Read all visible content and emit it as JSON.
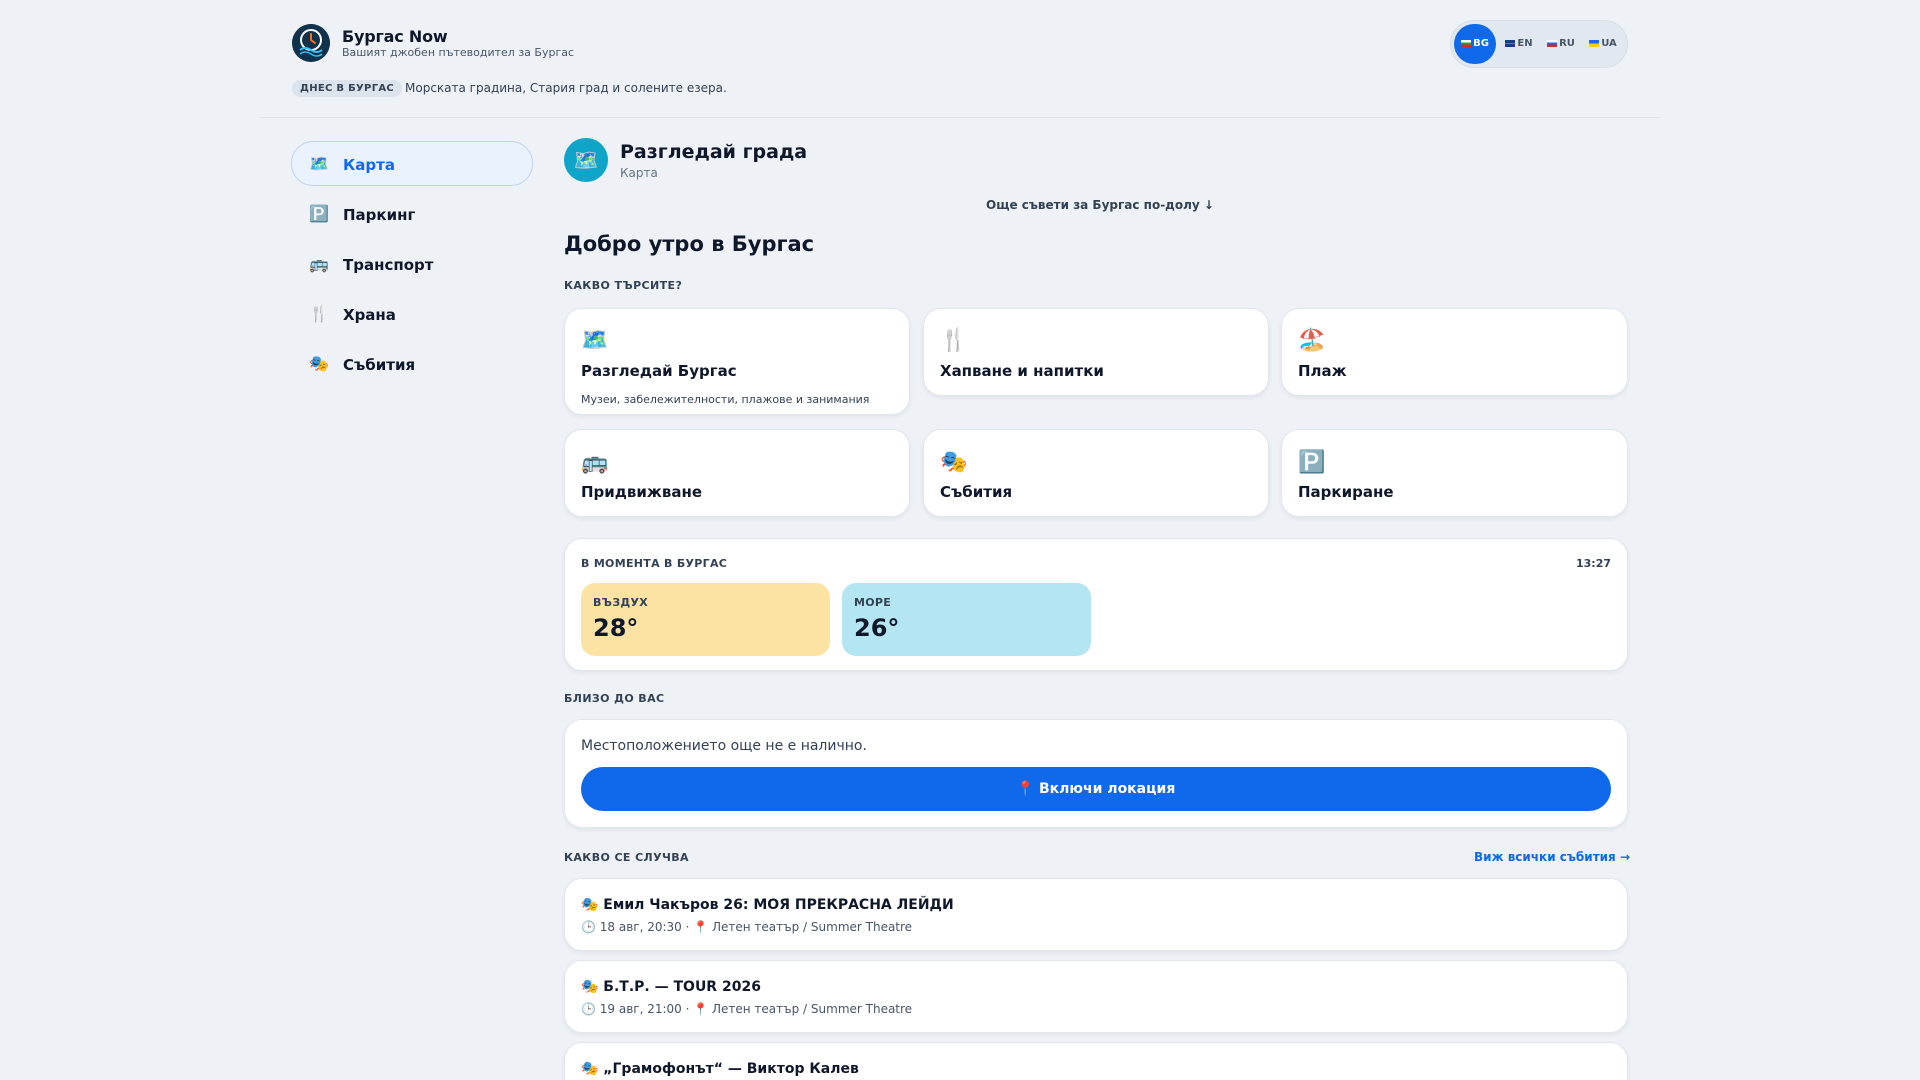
{
  "brand": {
    "title": "Бургас Now",
    "subtitle": "Вашият джобен пътеводител за Бургас",
    "logo_icon": "compass-clock-wave-logo"
  },
  "today": {
    "badge": "ДНЕС В БУРГАС",
    "text": "Морската градина, Стария град и солените езера."
  },
  "languages": [
    {
      "code": "BG",
      "flag": "bg-flag-icon",
      "active": true
    },
    {
      "code": "EN",
      "flag": "gb-flag-icon",
      "active": false
    },
    {
      "code": "RU",
      "flag": "ru-flag-icon",
      "active": false
    },
    {
      "code": "UA",
      "flag": "ua-flag-icon",
      "active": false
    }
  ],
  "sidebar": {
    "items": [
      {
        "label": "Карта",
        "icon": "🗺️",
        "icon_name": "map-icon",
        "active": true
      },
      {
        "label": "Паркинг",
        "icon": "🅿️",
        "icon_name": "parking-icon",
        "active": false
      },
      {
        "label": "Транспорт",
        "icon": "🚌",
        "icon_name": "bus-icon",
        "active": false
      },
      {
        "label": "Храна",
        "icon": "🍴",
        "icon_name": "fork-knife-icon",
        "active": false
      },
      {
        "label": "Събития",
        "icon": "🎭",
        "icon_name": "theater-masks-icon",
        "active": false
      }
    ]
  },
  "page": {
    "icon": "🗺️",
    "title": "Разгледай града",
    "subtitle": "Карта",
    "more_tips": "Още съвети за Бургас по-долу ↓",
    "greeting": "Добро утро в Бургас"
  },
  "search": {
    "label": "КАКВО ТЪРСИТЕ?",
    "cards": [
      {
        "icon": "🗺️",
        "icon_name": "map-icon",
        "title": "Разгледай Бургас",
        "desc": "Музеи, забележителности, плажове и занимания"
      },
      {
        "icon": "🍴",
        "icon_name": "fork-knife-icon",
        "title": "Хапване и напитки",
        "desc": ""
      },
      {
        "icon": "🏖️",
        "icon_name": "beach-umbrella-icon",
        "title": "Плаж",
        "desc": ""
      },
      {
        "icon": "🚌",
        "icon_name": "bus-icon",
        "title": "Придвижване",
        "desc": ""
      },
      {
        "icon": "🎭",
        "icon_name": "theater-masks-icon",
        "title": "Събития",
        "desc": ""
      },
      {
        "icon": "🅿️",
        "icon_name": "parking-icon",
        "title": "Паркиране",
        "desc": ""
      }
    ]
  },
  "weather": {
    "label": "В МОМЕНТА В БУРГАС",
    "time": "13:27",
    "air": {
      "label": "ВЪЗДУХ",
      "value": "28°",
      "color": "#fce3a4"
    },
    "sea": {
      "label": "МОРЕ",
      "value": "26°",
      "color": "#b4e5f2"
    }
  },
  "nearby": {
    "label": "БЛИЗО ДО ВАС",
    "text": "Местоположението още не е налично.",
    "button": "📍 Включи локация"
  },
  "events": {
    "label": "КАКВО СЕ СЛУЧВА",
    "see_all": "Виж всички събития →",
    "items": [
      {
        "title": "🎭 Емил Чакъров 26: МОЯ ПРЕКРАСНА ЛЕЙДИ",
        "meta": "🕒 18 авг, 20:30 · 📍 Летен театър / Summer Theatre"
      },
      {
        "title": "🎭 Б.Т.Р. — TOUR 2026",
        "meta": "🕒 19 авг, 21:00 · 📍 Летен театър / Summer Theatre"
      },
      {
        "title": "🎭 „Грамофонът“ — Виктор Калев",
        "meta": ""
      }
    ]
  },
  "colors": {
    "accent": "#1068ea",
    "background": "#eef2f6",
    "page_icon_bg": "#0ea5c9"
  }
}
